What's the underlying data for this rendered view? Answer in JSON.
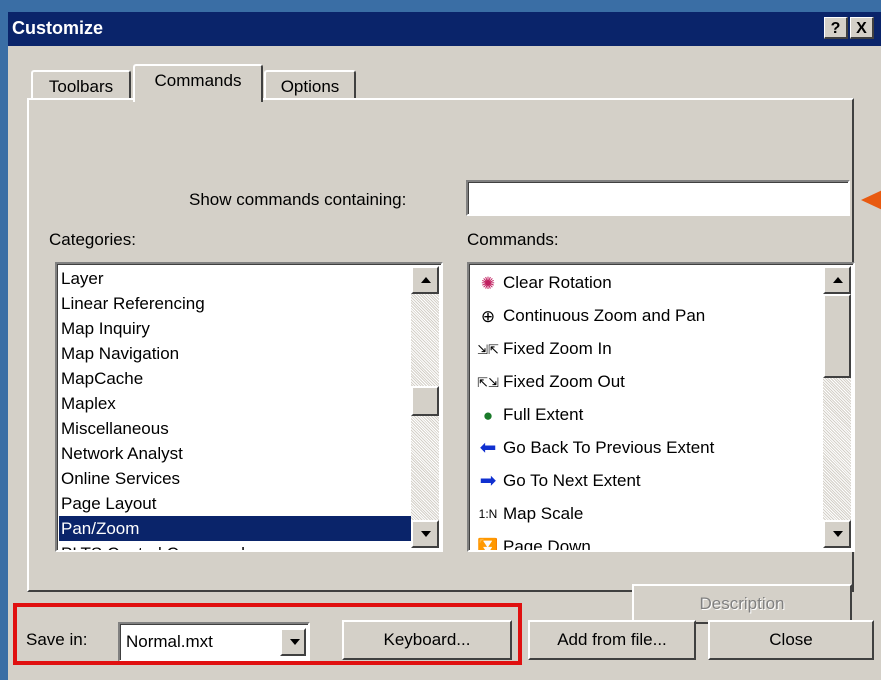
{
  "window": {
    "title": "Customize",
    "help_label": "?",
    "close_label": "X"
  },
  "tabs": [
    {
      "label": "Toolbars"
    },
    {
      "label": "Commands"
    },
    {
      "label": "Options"
    }
  ],
  "search": {
    "label": "Show commands containing:",
    "value": ""
  },
  "categories": {
    "label": "Categories:",
    "items": [
      "Layer",
      "Linear Referencing",
      "Map Inquiry",
      "Map Navigation",
      "MapCache",
      "Maplex",
      "Miscellaneous",
      "Network Analyst",
      "Online Services",
      "Page Layout",
      "Pan/Zoom",
      "PLTS Central Commands"
    ],
    "selected": "Pan/Zoom"
  },
  "commands": {
    "label": "Commands:",
    "items": [
      {
        "label": "Clear Rotation",
        "icon": "clear-rotation-icon"
      },
      {
        "label": "Continuous Zoom and Pan",
        "icon": "continuous-zoom-icon"
      },
      {
        "label": "Fixed Zoom In",
        "icon": "fixed-zoom-in-icon"
      },
      {
        "label": "Fixed Zoom Out",
        "icon": "fixed-zoom-out-icon"
      },
      {
        "label": "Full Extent",
        "icon": "globe-icon"
      },
      {
        "label": "Go Back To Previous Extent",
        "icon": "arrow-left-icon"
      },
      {
        "label": "Go To Next Extent",
        "icon": "arrow-right-icon"
      },
      {
        "label": "Map Scale",
        "icon": "map-scale-icon",
        "icon_text": "1:N"
      },
      {
        "label": "Page Down",
        "icon": "page-down-icon"
      }
    ]
  },
  "buttons": {
    "description": "Description",
    "keyboard": "Keyboard...",
    "add_from_file": "Add from file...",
    "close": "Close"
  },
  "save_in": {
    "label": "Save in:",
    "value": "Normal.mxt"
  },
  "colors": {
    "titlebar": "#0a246a",
    "dialog": "#d4d0c8",
    "highlight_box": "#e01010",
    "pointer_arrow": "#e85a10"
  }
}
